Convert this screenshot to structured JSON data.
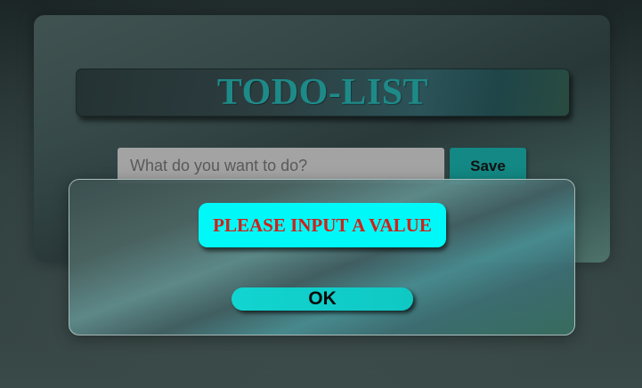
{
  "app": {
    "title": "TODO-LIST"
  },
  "todo_form": {
    "input_value": "",
    "input_placeholder": "What do you want to do?",
    "save_label": "Save"
  },
  "modal": {
    "message": "PLEASE INPUT A VALUE",
    "ok_label": "OK"
  },
  "colors": {
    "title_text": "#1e8a88",
    "save_button": "#138884",
    "alert_background": "#00f8f8",
    "alert_text": "#d0201a",
    "ok_button": "#12d4d0"
  }
}
